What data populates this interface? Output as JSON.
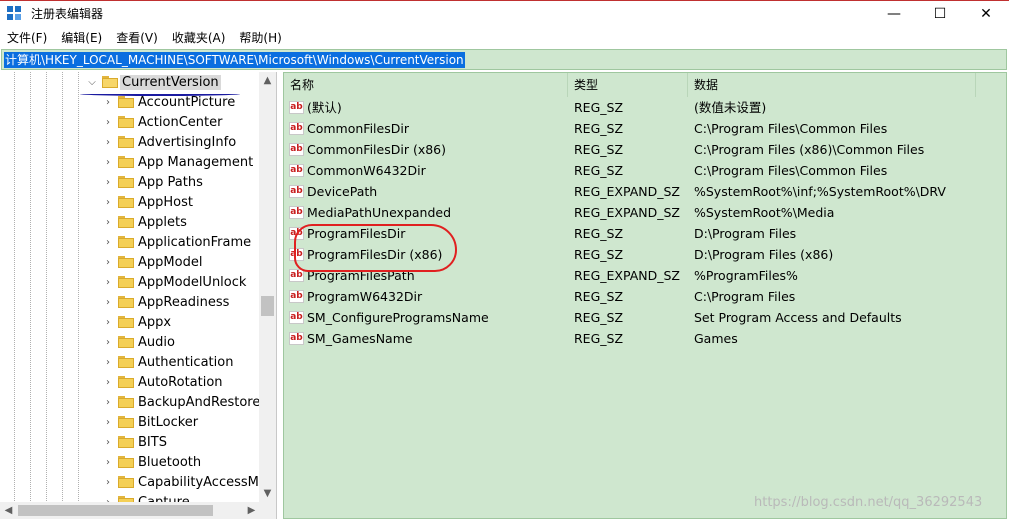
{
  "window": {
    "title": "注册表编辑器",
    "buttons": {
      "minimize": "—",
      "maximize": "☐",
      "close": "✕"
    }
  },
  "menu": [
    "文件(F)",
    "编辑(E)",
    "查看(V)",
    "收藏夹(A)",
    "帮助(H)"
  ],
  "address": "计算机\\HKEY_LOCAL_MACHINE\\SOFTWARE\\Microsoft\\Windows\\CurrentVersion",
  "tree": {
    "selected": "CurrentVersion",
    "items": [
      "AccountPicture",
      "ActionCenter",
      "AdvertisingInfo",
      "App Management",
      "App Paths",
      "AppHost",
      "Applets",
      "ApplicationFrame",
      "AppModel",
      "AppModelUnlock",
      "AppReadiness",
      "Appx",
      "Audio",
      "Authentication",
      "AutoRotation",
      "BackupAndRestoreSe",
      "BitLocker",
      "BITS",
      "Bluetooth",
      "CapabilityAccessMan",
      "Capture"
    ]
  },
  "values": {
    "columns": [
      "名称",
      "类型",
      "数据"
    ],
    "rows": [
      {
        "name": "(默认)",
        "type": "REG_SZ",
        "data": "(数值未设置)"
      },
      {
        "name": "CommonFilesDir",
        "type": "REG_SZ",
        "data": "C:\\Program Files\\Common Files"
      },
      {
        "name": "CommonFilesDir (x86)",
        "type": "REG_SZ",
        "data": "C:\\Program Files (x86)\\Common Files"
      },
      {
        "name": "CommonW6432Dir",
        "type": "REG_SZ",
        "data": "C:\\Program Files\\Common Files"
      },
      {
        "name": "DevicePath",
        "type": "REG_EXPAND_SZ",
        "data": "%SystemRoot%\\inf;%SystemRoot%\\DRV"
      },
      {
        "name": "MediaPathUnexpanded",
        "type": "REG_EXPAND_SZ",
        "data": "%SystemRoot%\\Media"
      },
      {
        "name": "ProgramFilesDir",
        "type": "REG_SZ",
        "data": "D:\\Program Files"
      },
      {
        "name": "ProgramFilesDir (x86)",
        "type": "REG_SZ",
        "data": "D:\\Program Files (x86)"
      },
      {
        "name": "ProgramFilesPath",
        "type": "REG_EXPAND_SZ",
        "data": "%ProgramFiles%"
      },
      {
        "name": "ProgramW6432Dir",
        "type": "REG_SZ",
        "data": "C:\\Program Files"
      },
      {
        "name": "SM_ConfigureProgramsName",
        "type": "REG_SZ",
        "data": "Set Program Access and Defaults"
      },
      {
        "name": "SM_GamesName",
        "type": "REG_SZ",
        "data": "Games"
      }
    ],
    "icon_text": "ab"
  },
  "watermark": "https://blog.csdn.net/qq_36292543",
  "colors": {
    "pane_bg": "#cfe7cf",
    "selection": "#0a6ee0",
    "annotation_red": "#e02020",
    "annotation_blue": "#1a1aa0"
  },
  "icons": {
    "app": "registry-editor-icon",
    "folder": "folder-icon",
    "value": "string-value-icon"
  }
}
